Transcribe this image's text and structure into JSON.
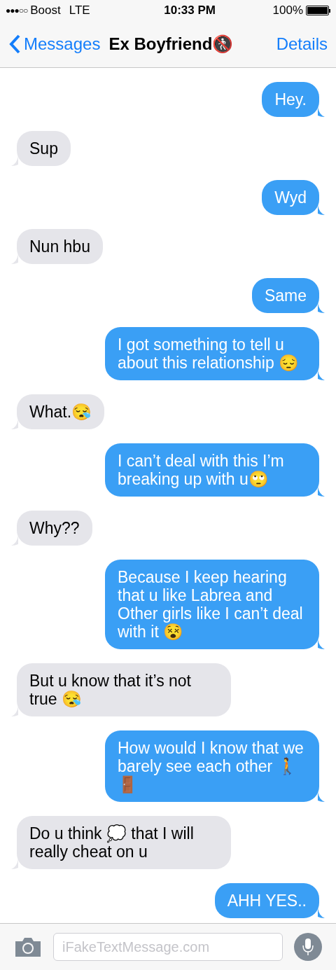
{
  "status_bar": {
    "signal": "●●●○○",
    "carrier": "Boost",
    "network": "LTE",
    "time": "10:33 PM",
    "battery": "100%"
  },
  "nav": {
    "back": "Messages",
    "title": "Ex Boyfriend🚷",
    "action": "Details"
  },
  "messages": [
    {
      "outgoing": true,
      "text": "Hey."
    },
    {
      "outgoing": false,
      "text": "Sup"
    },
    {
      "outgoing": true,
      "text": "Wyd"
    },
    {
      "outgoing": false,
      "text": "Nun hbu"
    },
    {
      "outgoing": true,
      "text": "Same"
    },
    {
      "outgoing": true,
      "text": "I got something to tell u about this relationship 😔"
    },
    {
      "outgoing": false,
      "text": "What.😪"
    },
    {
      "outgoing": true,
      "text": "I can’t deal with this I’m breaking up with u🙄"
    },
    {
      "outgoing": false,
      "text": "Why??"
    },
    {
      "outgoing": true,
      "text": "Because I keep hearing that u like Labrea and Other girls like I can’t deal with it 😵"
    },
    {
      "outgoing": false,
      "text": "But u know that it’s not true 😪"
    },
    {
      "outgoing": true,
      "text": "How would I know that we barely see each other 🚶🚪"
    },
    {
      "outgoing": false,
      "text": "Do u think 💭 that I will really cheat on u"
    },
    {
      "outgoing": true,
      "text": "AHH YES.."
    }
  ],
  "composer": {
    "placeholder": "iFakeTextMessage.com"
  }
}
